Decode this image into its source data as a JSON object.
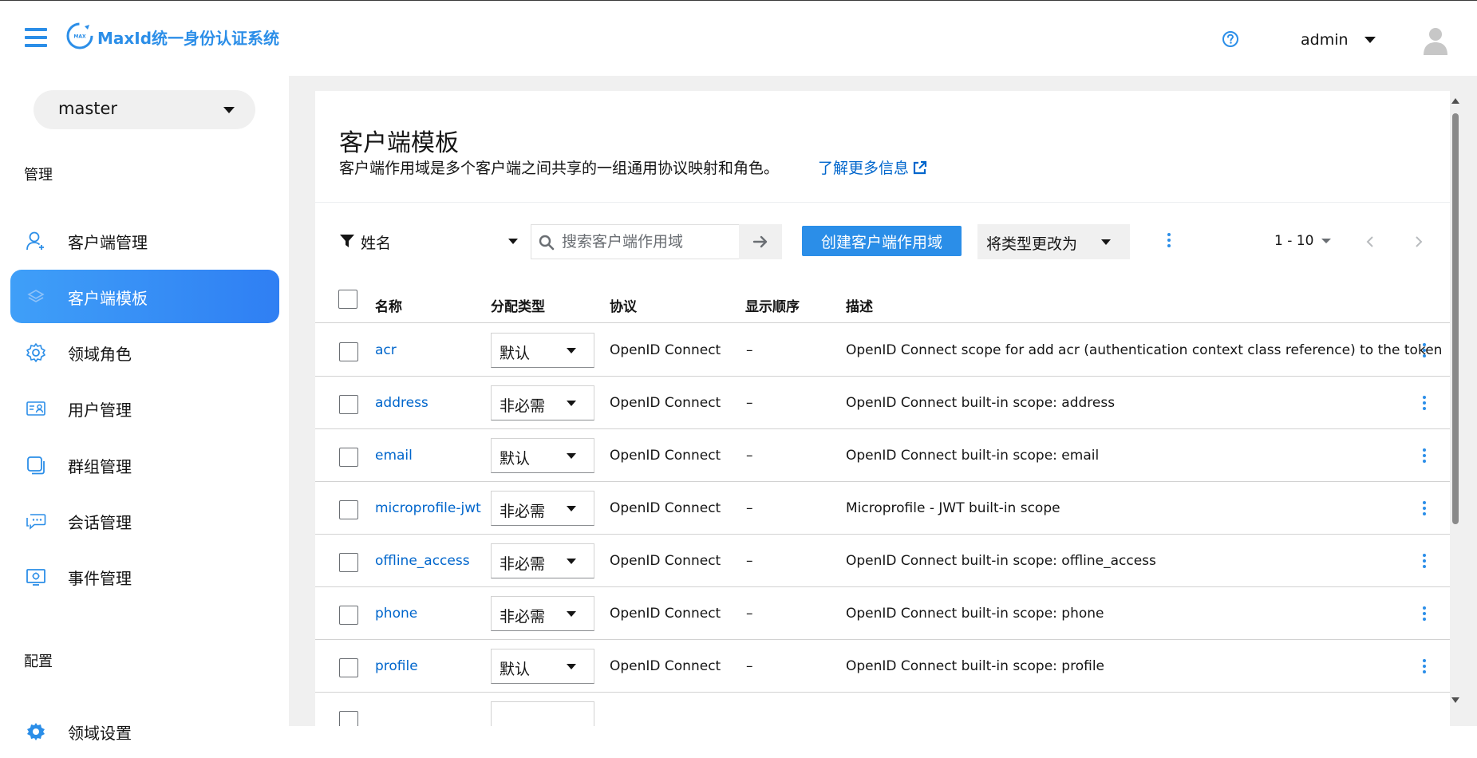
{
  "header": {
    "brand": "MaxId统一身份认证系统",
    "user": "admin"
  },
  "sidebar": {
    "realm": "master",
    "section_manage": "管理",
    "items": [
      {
        "label": "客户端管理",
        "icon": "user-outline-icon",
        "active": false
      },
      {
        "label": "客户端模板",
        "icon": "layers-icon",
        "active": true
      },
      {
        "label": "领域角色",
        "icon": "gear-icon",
        "active": false
      },
      {
        "label": "用户管理",
        "icon": "id-card-icon",
        "active": false
      },
      {
        "label": "群组管理",
        "icon": "group-square-icon",
        "active": false
      },
      {
        "label": "会话管理",
        "icon": "chat-bubble-icon",
        "active": false
      },
      {
        "label": "事件管理",
        "icon": "event-monitor-icon",
        "active": false
      }
    ],
    "section_config": "配置",
    "config_items": [
      {
        "label": "领域设置",
        "icon": "gear-filled-icon"
      }
    ]
  },
  "page": {
    "title": "客户端模板",
    "description": "客户端作用域是多个客户端之间共享的一组通用协议映射和角色。",
    "learn_more": "了解更多信息"
  },
  "toolbar": {
    "filter_label": "姓名",
    "search_placeholder": "搜索客户端作用域",
    "create_button": "创建客户端作用域",
    "type_change": "将类型更改为",
    "pagination": "1 - 10"
  },
  "table": {
    "columns": [
      "名称",
      "分配类型",
      "协议",
      "显示顺序",
      "描述"
    ],
    "rows": [
      {
        "name": "acr",
        "type": "默认",
        "protocol": "OpenID Connect",
        "order": "–",
        "description": "OpenID Connect scope for add acr (authentication context class reference) to the token"
      },
      {
        "name": "address",
        "type": "非必需",
        "protocol": "OpenID Connect",
        "order": "–",
        "description": "OpenID Connect built-in scope: address"
      },
      {
        "name": "email",
        "type": "默认",
        "protocol": "OpenID Connect",
        "order": "–",
        "description": "OpenID Connect built-in scope: email"
      },
      {
        "name": "microprofile-jwt",
        "type": "非必需",
        "protocol": "OpenID Connect",
        "order": "–",
        "description": "Microprofile - JWT built-in scope"
      },
      {
        "name": "offline_access",
        "type": "非必需",
        "protocol": "OpenID Connect",
        "order": "–",
        "description": "OpenID Connect built-in scope: offline_access"
      },
      {
        "name": "phone",
        "type": "非必需",
        "protocol": "OpenID Connect",
        "order": "–",
        "description": "OpenID Connect built-in scope: phone"
      },
      {
        "name": "profile",
        "type": "默认",
        "protocol": "OpenID Connect",
        "order": "–",
        "description": "OpenID Connect built-in scope: profile"
      }
    ]
  },
  "colors": {
    "accent": "#2b8ee8",
    "link": "#0066cc",
    "active_nav_start": "#3f9ff8",
    "active_nav_end": "#2f7ff3"
  }
}
